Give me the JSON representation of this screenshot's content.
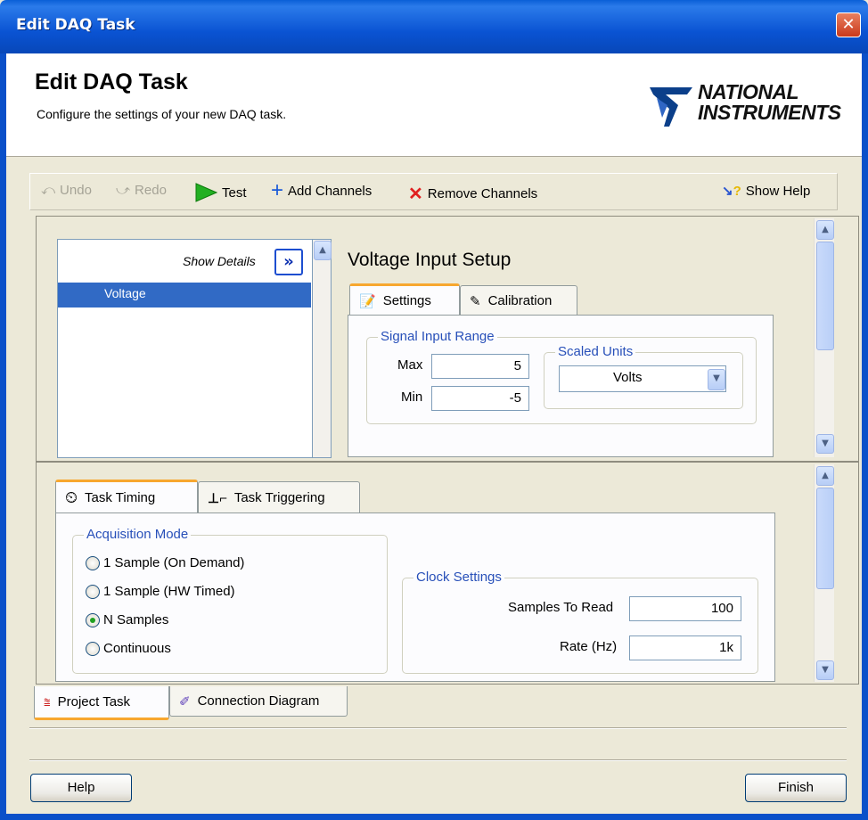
{
  "window": {
    "title": "Edit DAQ Task",
    "close_glyph": "✕"
  },
  "header": {
    "title": "Edit DAQ Task",
    "subtitle": "Configure the settings of your new DAQ task.",
    "logo_line1": "NATIONAL",
    "logo_line2": "INSTRUMENTS"
  },
  "toolbar": {
    "undo": "Undo",
    "redo": "Redo",
    "test": "Test",
    "add_channels": "Add Channels",
    "remove_channels": "Remove Channels",
    "show_help": "Show Help"
  },
  "channels": {
    "show_details": "Show Details",
    "expand_glyph": "»",
    "items": [
      "Voltage"
    ]
  },
  "setup": {
    "title": "Voltage Input Setup",
    "tabs": {
      "settings": "Settings",
      "calibration": "Calibration"
    },
    "signal_range": {
      "legend": "Signal Input Range",
      "max_label": "Max",
      "max_value": "5",
      "min_label": "Min",
      "min_value": "-5"
    },
    "scaled_units": {
      "legend": "Scaled Units",
      "selected": "Volts"
    }
  },
  "timing": {
    "tabs": {
      "task_timing": "Task Timing",
      "task_triggering": "Task Triggering"
    },
    "acquisition_mode": {
      "legend": "Acquisition Mode",
      "options": [
        "1 Sample (On Demand)",
        "1 Sample (HW Timed)",
        "N Samples",
        "Continuous"
      ],
      "selected": "N Samples"
    },
    "clock": {
      "legend": "Clock Settings",
      "samples_label": "Samples To Read",
      "samples_value": "100",
      "rate_label": "Rate (Hz)",
      "rate_value": "1k"
    }
  },
  "bottom_tabs": {
    "project_task": "Project Task",
    "connection_diagram": "Connection Diagram"
  },
  "buttons": {
    "help": "Help",
    "finish": "Finish"
  },
  "colors": {
    "titlebar": "#0a53d3",
    "selection": "#316ac5",
    "group_legend": "#2850b9",
    "tab_highlight": "#f7a72f"
  }
}
